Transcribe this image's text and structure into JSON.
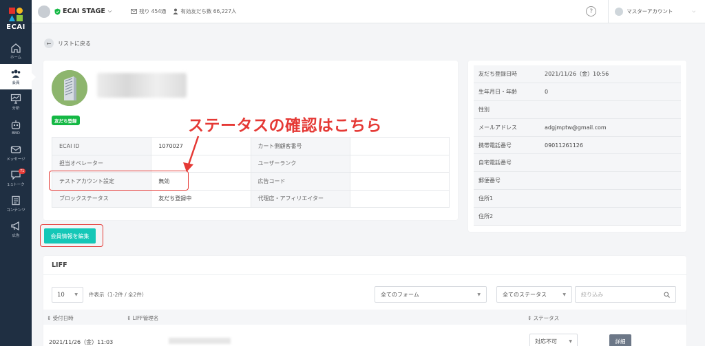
{
  "colors": {
    "sidebar": "#1f2f42",
    "accent": "#15c7b7",
    "badge_green": "#14b844",
    "annotation_red": "#e53935"
  },
  "sidebar": {
    "logo": "ECAI",
    "items": [
      {
        "label": "ホーム",
        "icon": "home-icon"
      },
      {
        "label": "会員",
        "icon": "members-icon"
      },
      {
        "label": "分析",
        "icon": "analytics-icon"
      },
      {
        "label": "BBO",
        "icon": "robot-icon"
      },
      {
        "label": "メッセージ",
        "icon": "message-icon"
      },
      {
        "label": "1:1トーク",
        "icon": "chat-icon",
        "badge": "71"
      },
      {
        "label": "コンテンツ",
        "icon": "content-icon"
      },
      {
        "label": "広告",
        "icon": "megaphone-icon"
      }
    ]
  },
  "topbar": {
    "stage": "ECAI STAGE",
    "remaining": "残り 454通",
    "friends": "有効友だち数 66,227人",
    "account": "マスターアカウント"
  },
  "back_label": "リストに戻る",
  "profile": {
    "friend_badge": "友だち登録",
    "table": [
      [
        "ECAI ID",
        "1070027",
        "カート側顧客番号",
        ""
      ],
      [
        "担当オペレーター",
        "",
        "ユーザーランク",
        ""
      ],
      [
        "テストアカウント設定",
        "無効",
        "広告コード",
        ""
      ],
      [
        "ブロックステータス",
        "友だち登録中",
        "代理店・アフィリエイター",
        ""
      ]
    ]
  },
  "annotation": "ステータスの確認はこちら",
  "edit_button": "会員情報を編集",
  "details": [
    [
      "友だち登録日時",
      "2021/11/26（金）10:56"
    ],
    [
      "生年月日・年齢",
      "0"
    ],
    [
      "性別",
      ""
    ],
    [
      "メールアドレス",
      "adgjmptw@gmail.com"
    ],
    [
      "携帯電話番号",
      "09011261126"
    ],
    [
      "自宅電話番号",
      ""
    ],
    [
      "郵便番号",
      ""
    ],
    [
      "住所1",
      ""
    ],
    [
      "住所2",
      ""
    ]
  ],
  "liff": {
    "title": "LIFF",
    "per_page": "10",
    "count_text": "件表示（1-2件 / 全2件）",
    "form_filter": "全てのフォーム",
    "status_filter": "全てのステータス",
    "search_placeholder": "絞り込み",
    "headers": {
      "date": "受付日時",
      "name": "LIFF管理名",
      "status": "ステータス"
    },
    "row": {
      "date": "2021/11/26（金）11:03",
      "status": "対応不可",
      "detail": "詳細"
    }
  }
}
